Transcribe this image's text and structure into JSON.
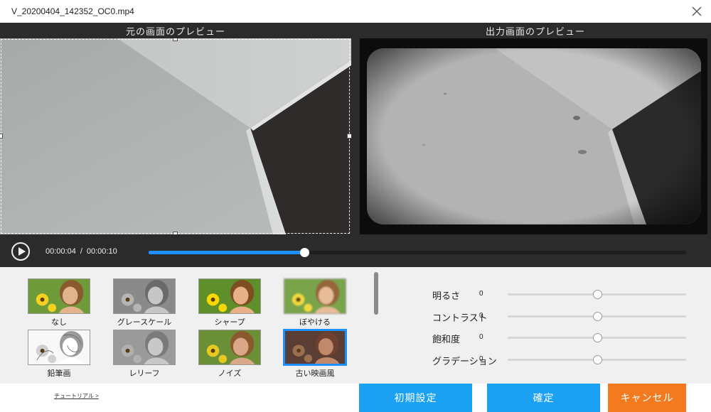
{
  "window": {
    "title": "V_20200404_142352_OC0.mp4"
  },
  "preview": {
    "original_label": "元の画面のプレビュー",
    "output_label": "出力画面のプレビュー"
  },
  "player": {
    "current_time": "00:00:04",
    "separator": "/",
    "total_time": "00:00:10",
    "progress": 0.29
  },
  "effects": [
    {
      "label": "なし",
      "icon": "girl-sunflowers-thumbnail"
    },
    {
      "label": "グレースケール",
      "icon": "girl-sunflowers-thumbnail"
    },
    {
      "label": "シャープ",
      "icon": "girl-sunflowers-thumbnail"
    },
    {
      "label": "ぼやける",
      "icon": "girl-sunflowers-thumbnail"
    },
    {
      "label": "鉛筆画",
      "icon": "girl-sunflowers-thumbnail"
    },
    {
      "label": "レリーフ",
      "icon": "girl-sunflowers-thumbnail"
    },
    {
      "label": "ノイズ",
      "icon": "girl-sunflowers-thumbnail"
    },
    {
      "label": "古い映画風",
      "icon": "girl-sunflowers-thumbnail",
      "selected": true
    }
  ],
  "adjustments": [
    {
      "label": "明るさ",
      "value": "0",
      "level": 0.5
    },
    {
      "label": "コントラスト",
      "value": "0",
      "level": 0.5
    },
    {
      "label": "飽和度",
      "value": "0",
      "level": 0.5
    },
    {
      "label": "グラデーション",
      "value": "0",
      "level": 0.5
    }
  ],
  "footer": {
    "tutorial_link": "チュートリアル >",
    "reset_button": "初期設定",
    "ok_button": "確定",
    "cancel_button": "キャンセル"
  },
  "colors": {
    "accent": "#1ba1f2",
    "cancel": "#f47a1f",
    "progress": "#1e8fff",
    "preview_bg": "#2b2b2b"
  }
}
